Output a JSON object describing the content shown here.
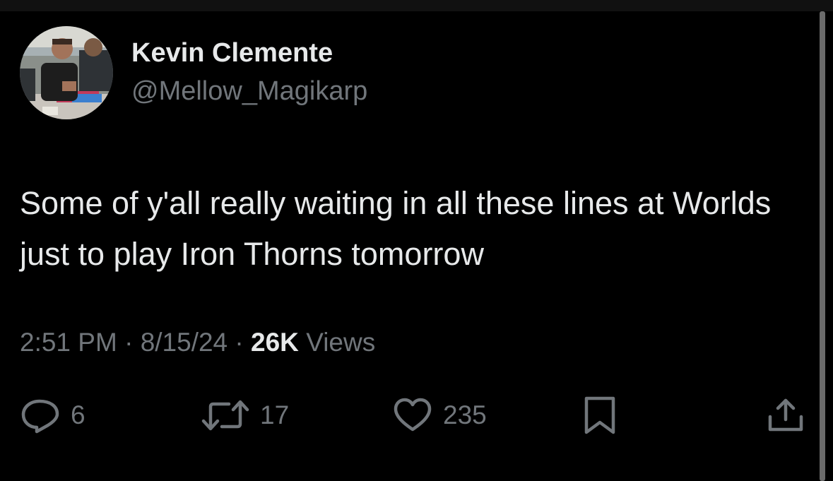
{
  "user": {
    "display_name": "Kevin Clemente",
    "handle": "@Mellow_Magikarp",
    "avatar_icon": "profile-photo"
  },
  "tweet": {
    "text": "Some of y'all really waiting in all these lines at Worlds just to play Iron Thorns tomorrow"
  },
  "meta": {
    "time": "2:51 PM",
    "separator": "·",
    "date": "8/15/24",
    "views_count": "26K",
    "views_label": "Views"
  },
  "actions": {
    "reply": {
      "icon": "reply-icon",
      "count": "6"
    },
    "retweet": {
      "icon": "retweet-icon",
      "count": "17"
    },
    "like": {
      "icon": "heart-icon",
      "count": "235"
    },
    "bookmark": {
      "icon": "bookmark-icon"
    },
    "share": {
      "icon": "share-icon"
    }
  },
  "colors": {
    "background": "#000000",
    "primary_text": "#e7e9ea",
    "secondary_text": "#71767b",
    "scrollbar": "#6b6b6b"
  }
}
